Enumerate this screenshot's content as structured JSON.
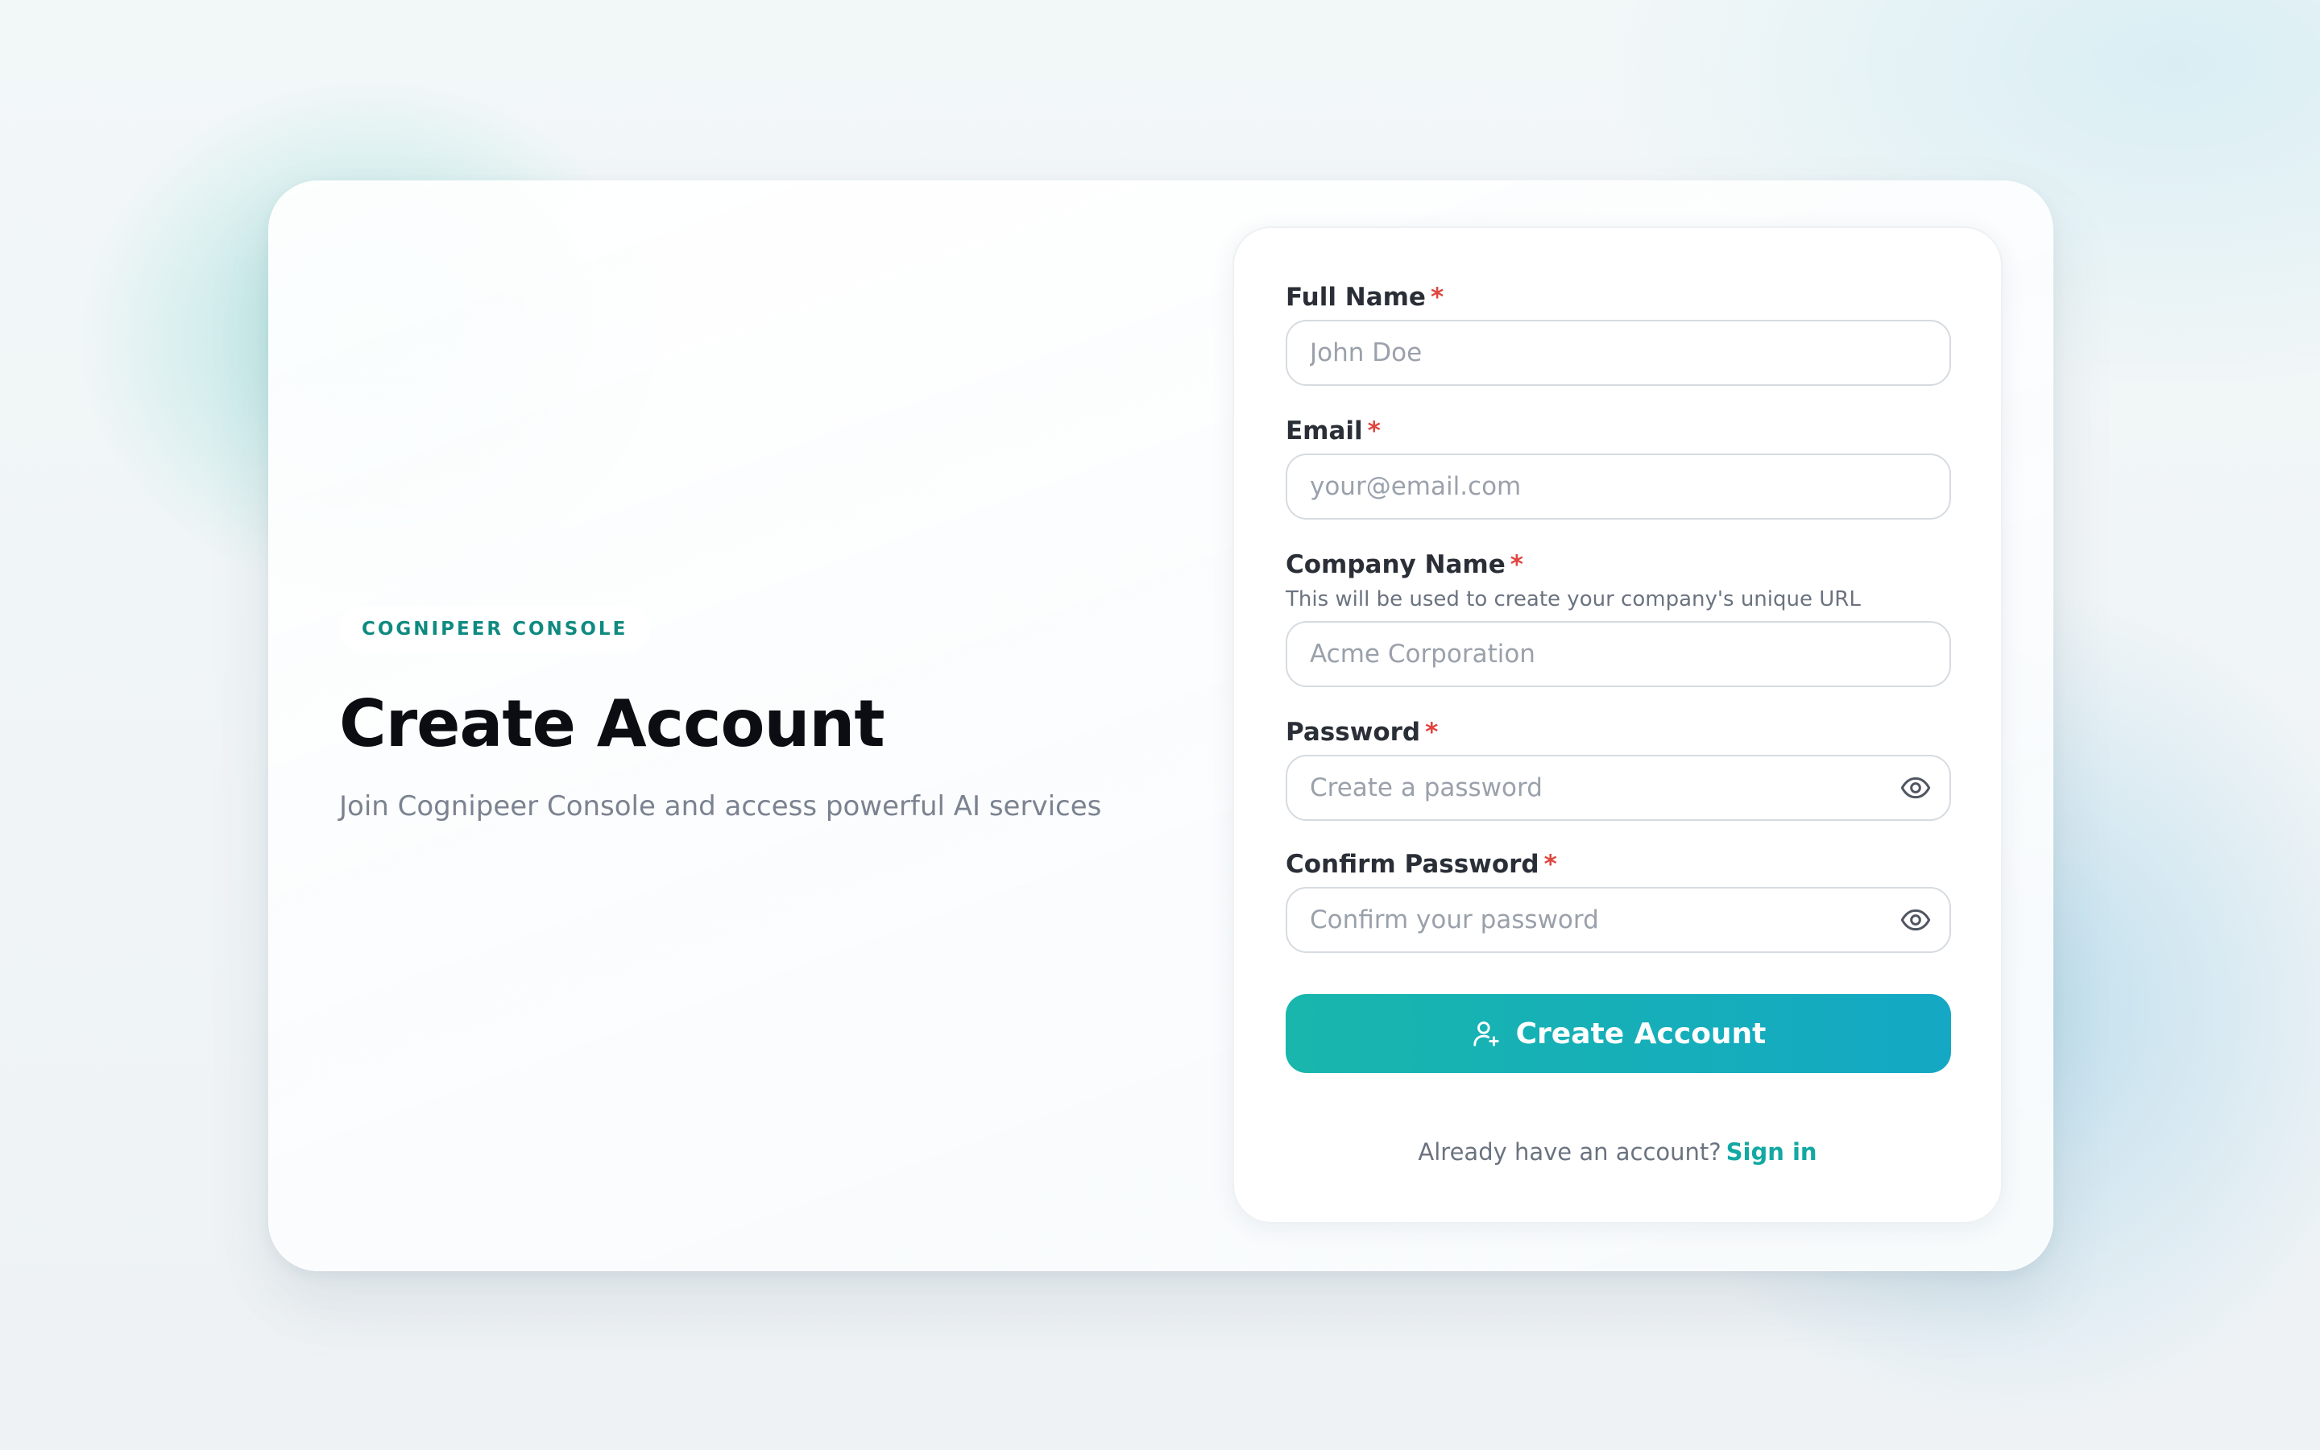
{
  "brand": {
    "badge": "COGNIPEER CONSOLE"
  },
  "hero": {
    "title": "Create Account",
    "subtitle": "Join Cognipeer Console and access powerful AI services"
  },
  "form": {
    "required_marker": "*",
    "full_name": {
      "label": "Full Name",
      "placeholder": "John Doe",
      "value": ""
    },
    "email": {
      "label": "Email",
      "placeholder": "your@email.com",
      "value": ""
    },
    "company_name": {
      "label": "Company Name",
      "hint": "This will be used to create your company's unique URL",
      "placeholder": "Acme Corporation",
      "value": ""
    },
    "password": {
      "label": "Password",
      "placeholder": "Create a password",
      "value": "",
      "toggle_icon": "eye-icon"
    },
    "confirm_password": {
      "label": "Confirm Password",
      "placeholder": "Confirm your password",
      "value": "",
      "toggle_icon": "eye-icon"
    },
    "submit": {
      "label": "Create Account",
      "icon": "user-plus-icon"
    },
    "footer": {
      "text": "Already have an account?",
      "link": "Sign in"
    }
  },
  "colors": {
    "accent": "#18b6ac",
    "accent_end": "#14a8c4",
    "badge_text": "#0f8a80",
    "required": "#e0453e"
  }
}
